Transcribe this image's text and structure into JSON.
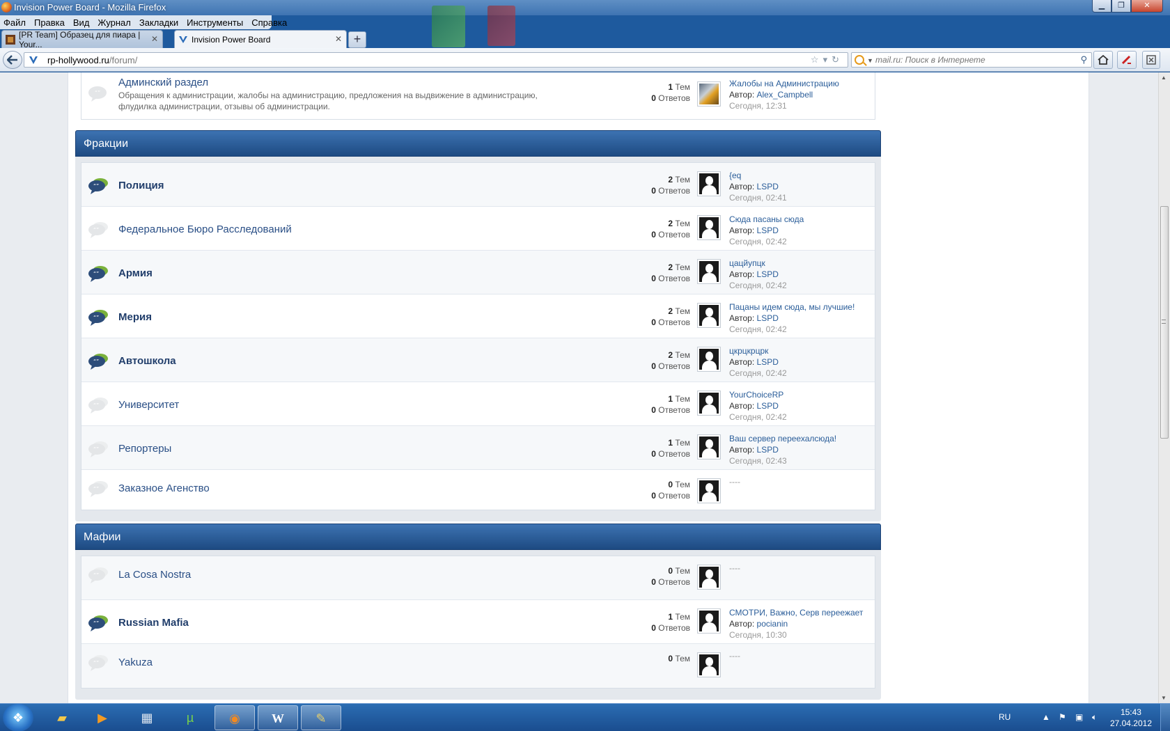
{
  "window": {
    "title": "Invision Power Board - Mozilla Firefox",
    "controls": {
      "minimize": "▁",
      "maximize": "❐",
      "close": "✕"
    }
  },
  "menu": [
    "Файл",
    "Правка",
    "Вид",
    "Журнал",
    "Закладки",
    "Инструменты",
    "Справка"
  ],
  "tabs": [
    {
      "label": "[PR Team] Образец для пиара | Your...",
      "active": false,
      "close": "✕"
    },
    {
      "label": "Invision Power Board",
      "active": true,
      "close": "✕"
    }
  ],
  "new_tab_label": "+",
  "address": {
    "host": "rp-hollywood.ru",
    "path": "/forum/"
  },
  "search": {
    "placeholder": "mail.ru: Поиск в Интернете"
  },
  "top_row": {
    "name": "Админский раздел",
    "description": "Обращения к администрации, жалобы на администрацию, предложения на выдвижение в администрацию, флудилка администрации, отзывы об администрации.",
    "topics": "1",
    "topics_label": "Тем",
    "replies": "0",
    "replies_label": "Ответов",
    "last_title": "Жалобы на Администрацию",
    "last_author_label": "Автор:",
    "last_author": "Alex_Campbell",
    "last_date": "Сегодня, 12:31"
  },
  "categories": [
    {
      "title": "Фракции",
      "forums": [
        {
          "name": "Полиция",
          "unread": true,
          "topics": "2",
          "replies": "0",
          "last_title": "{eq",
          "last_author": "LSPD",
          "last_date": "Сегодня, 02:41"
        },
        {
          "name": "Федеральное Бюро Расследований",
          "unread": false,
          "topics": "2",
          "replies": "0",
          "last_title": "Сюда пасаны сюда",
          "last_author": "LSPD",
          "last_date": "Сегодня, 02:42"
        },
        {
          "name": "Армия",
          "unread": true,
          "topics": "2",
          "replies": "0",
          "last_title": "цацйупцк",
          "last_author": "LSPD",
          "last_date": "Сегодня, 02:42"
        },
        {
          "name": "Мерия",
          "unread": true,
          "topics": "2",
          "replies": "0",
          "last_title": "Пацаны идем сюда, мы лучшие!",
          "last_author": "LSPD",
          "last_date": "Сегодня, 02:42"
        },
        {
          "name": "Автошкола",
          "unread": true,
          "topics": "2",
          "replies": "0",
          "last_title": "цкрцкрцрк",
          "last_author": "LSPD",
          "last_date": "Сегодня, 02:42"
        },
        {
          "name": "Университет",
          "unread": false,
          "topics": "1",
          "replies": "0",
          "last_title": "YourChoiceRP",
          "last_author": "LSPD",
          "last_date": "Сегодня, 02:42"
        },
        {
          "name": "Репортеры",
          "unread": false,
          "topics": "1",
          "replies": "0",
          "last_title": "Ваш сервер переехалсюда!",
          "last_author": "LSPD",
          "last_date": "Сегодня, 02:43"
        },
        {
          "name": "Заказное Агенство",
          "unread": false,
          "topics": "0",
          "replies": "0",
          "last_title": "----",
          "last_author": "",
          "last_date": ""
        }
      ]
    },
    {
      "title": "Мафии",
      "forums": [
        {
          "name": "La Cosa Nostra",
          "unread": false,
          "topics": "0",
          "replies": "0",
          "last_title": "----",
          "last_author": "",
          "last_date": ""
        },
        {
          "name": "Russian Mafia",
          "unread": true,
          "topics": "1",
          "replies": "0",
          "last_title": "СМОТРИ, Важно, Серв переежает",
          "last_author": "pocianin",
          "last_date": "Сегодня, 10:30"
        },
        {
          "name": "Yakuza",
          "unread": false,
          "topics": "0",
          "replies": "",
          "last_title": "----",
          "last_author": "",
          "last_date": ""
        }
      ]
    }
  ],
  "labels": {
    "topics": "Тем",
    "replies": "Ответов",
    "author": "Автор:"
  },
  "taskbar": {
    "apps": [
      "explorer",
      "media-player",
      "calculator",
      "utorrent",
      "firefox",
      "word",
      "paint"
    ],
    "lang": "RU",
    "time": "15:43",
    "date": "27.04.2012"
  },
  "colors": {
    "accent": "#2a4f86",
    "header": "#1d4a82",
    "link": "#2a5d99"
  }
}
